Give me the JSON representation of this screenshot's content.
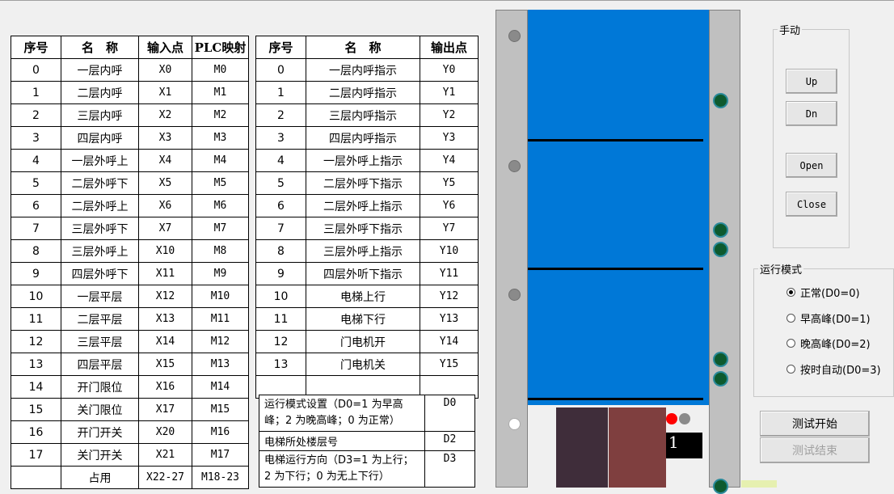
{
  "input_table": {
    "headers": [
      "序号",
      "名　称",
      "输入点",
      "PLC映射"
    ],
    "rows": [
      [
        "0",
        "一层内呼",
        "X0",
        "M0"
      ],
      [
        "1",
        "二层内呼",
        "X1",
        "M1"
      ],
      [
        "2",
        "三层内呼",
        "X2",
        "M2"
      ],
      [
        "3",
        "四层内呼",
        "X3",
        "M3"
      ],
      [
        "4",
        "一层外呼上",
        "X4",
        "M4"
      ],
      [
        "5",
        "二层外呼下",
        "X5",
        "M5"
      ],
      [
        "6",
        "二层外呼上",
        "X6",
        "M6"
      ],
      [
        "7",
        "三层外呼下",
        "X7",
        "M7"
      ],
      [
        "8",
        "三层外呼上",
        "X10",
        "M8"
      ],
      [
        "9",
        "四层外呼下",
        "X11",
        "M9"
      ],
      [
        "10",
        "一层平层",
        "X12",
        "M10"
      ],
      [
        "11",
        "二层平层",
        "X13",
        "M11"
      ],
      [
        "12",
        "三层平层",
        "X14",
        "M12"
      ],
      [
        "13",
        "四层平层",
        "X15",
        "M13"
      ],
      [
        "14",
        "开门限位",
        "X16",
        "M14"
      ],
      [
        "15",
        "关门限位",
        "X17",
        "M15"
      ],
      [
        "16",
        "开门开关",
        "X20",
        "M16"
      ],
      [
        "17",
        "关门开关",
        "X21",
        "M17"
      ],
      [
        "",
        "占用",
        "X22-27",
        "M18-23"
      ]
    ]
  },
  "output_table": {
    "headers": [
      "序号",
      "名　称",
      "输出点"
    ],
    "rows": [
      [
        "0",
        "一层内呼指示",
        "Y0"
      ],
      [
        "1",
        "二层内呼指示",
        "Y1"
      ],
      [
        "2",
        "三层内呼指示",
        "Y2"
      ],
      [
        "3",
        "四层内呼指示",
        "Y3"
      ],
      [
        "4",
        "一层外呼上指示",
        "Y4"
      ],
      [
        "5",
        "二层外呼下指示",
        "Y5"
      ],
      [
        "6",
        "二层外呼上指示",
        "Y6"
      ],
      [
        "7",
        "三层外呼下指示",
        "Y7"
      ],
      [
        "8",
        "三层外呼上指示",
        "Y10"
      ],
      [
        "9",
        "四层外听下指示",
        "Y11"
      ],
      [
        "10",
        "电梯上行",
        "Y12"
      ],
      [
        "11",
        "电梯下行",
        "Y13"
      ],
      [
        "12",
        "门电机开",
        "Y14"
      ],
      [
        "13",
        "门电机关",
        "Y15"
      ],
      [
        "",
        "",
        ""
      ]
    ]
  },
  "register_table": [
    {
      "desc": "运行模式设置（D0=1 为早高峰；2 为晚高峰；0 为正常）",
      "reg": "D0"
    },
    {
      "desc": "电梯所处楼层号",
      "reg": "D2"
    },
    {
      "desc": "电梯运行方向（D3=1 为上行；2 为下行；0 为无上下行）",
      "reg": "D3"
    }
  ],
  "elevator": {
    "floor_display": "1",
    "colors": {
      "shaft": "#0078d7",
      "door_left": "#3f2d3a",
      "door_right": "#7f3f3f",
      "indicator_red": "#ff0000"
    }
  },
  "manual": {
    "title": "手动",
    "up": "Up",
    "down": "Dn",
    "open": "Open",
    "close": "Close"
  },
  "mode": {
    "title": "运行模式",
    "options": [
      "正常(D0=0)",
      "早高峰(D0=1)",
      "晚高峰(D0=2)",
      "按时自动(D0=3)"
    ],
    "selected_index": 0
  },
  "test": {
    "start": "测试开始",
    "end": "测试结束"
  }
}
